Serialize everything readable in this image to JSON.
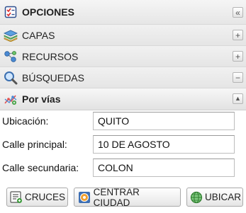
{
  "panel": {
    "header": {
      "label": "OPCIONES",
      "icon": "checklist-icon",
      "collapse_symbol": "«"
    },
    "sections": [
      {
        "label": "CAPAS",
        "icon": "layers-icon",
        "toggle_symbol": "+"
      },
      {
        "label": "RECURSOS",
        "icon": "network-icon",
        "toggle_symbol": "+"
      },
      {
        "label": "BÚSQUEDAS",
        "icon": "magnifier-icon",
        "toggle_symbol": "−"
      }
    ],
    "subheader": {
      "label": "Por vías",
      "icon": "route-icon",
      "toggle_symbol": "▲"
    }
  },
  "form": {
    "fields": [
      {
        "label": "Ubicación:",
        "value": "QUITO"
      },
      {
        "label": "Calle principal:",
        "value": "10 DE AGOSTO"
      },
      {
        "label": "Calle secundaria:",
        "value": "COLON"
      }
    ]
  },
  "buttons": [
    {
      "label": "CRUCES",
      "icon": "list-icon"
    },
    {
      "label": "CENTRAR CIUDAD",
      "icon": "target-icon"
    },
    {
      "label": "UBICAR",
      "icon": "globe-icon"
    }
  ],
  "colors": {
    "header_bg": "#e9e9e9",
    "accent_blue": "#2a6fb5",
    "accent_red": "#c0392b",
    "accent_green": "#3a9a3a"
  }
}
